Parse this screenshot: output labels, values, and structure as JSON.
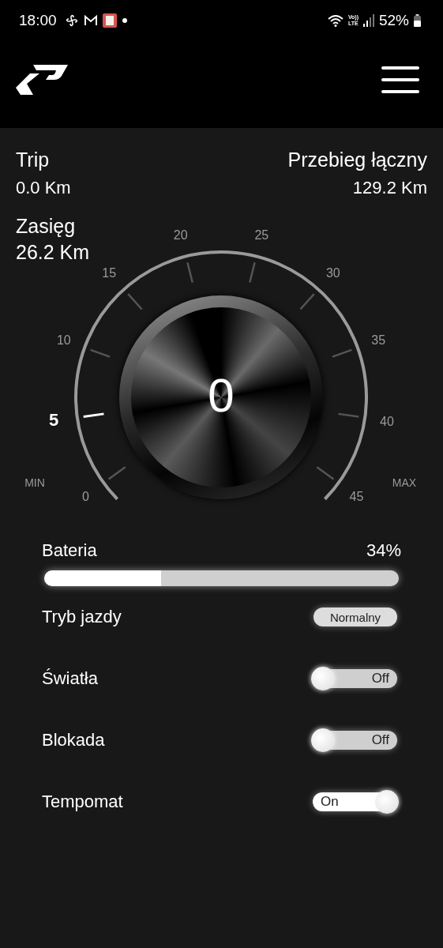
{
  "status_bar": {
    "time": "18:00",
    "volte_top": "Vo))",
    "volte_bottom": "LTE",
    "battery": "52%"
  },
  "stats": {
    "trip": {
      "label": "Trip",
      "value": "0.0 Km"
    },
    "total": {
      "label": "Przebieg łączny",
      "value": "129.2 Km"
    },
    "range": {
      "label": "Zasięg",
      "value": "26.2 Km"
    }
  },
  "gauge": {
    "min_label": "MIN",
    "max_label": "MAX",
    "reading": "0",
    "ticks": [
      {
        "label": "0",
        "selected": false
      },
      {
        "label": "5",
        "selected": true
      },
      {
        "label": "10",
        "selected": false
      },
      {
        "label": "15",
        "selected": false
      },
      {
        "label": "20",
        "selected": false
      },
      {
        "label": "25",
        "selected": false
      },
      {
        "label": "30",
        "selected": false
      },
      {
        "label": "35",
        "selected": false
      },
      {
        "label": "40",
        "selected": false
      },
      {
        "label": "45",
        "selected": false
      }
    ]
  },
  "battery": {
    "label": "Bateria",
    "reading": "34%",
    "level": 0.33
  },
  "settings": [
    {
      "kind": "mode",
      "label": "Tryb jazdy",
      "value": "Normalny"
    },
    {
      "kind": "toggle",
      "label": "Światła",
      "on": false,
      "state_label": "Off"
    },
    {
      "kind": "toggle",
      "label": "Blokada",
      "on": false,
      "state_label": "Off"
    },
    {
      "kind": "toggle",
      "label": "Tempomat",
      "on": true,
      "state_label": "On"
    }
  ]
}
